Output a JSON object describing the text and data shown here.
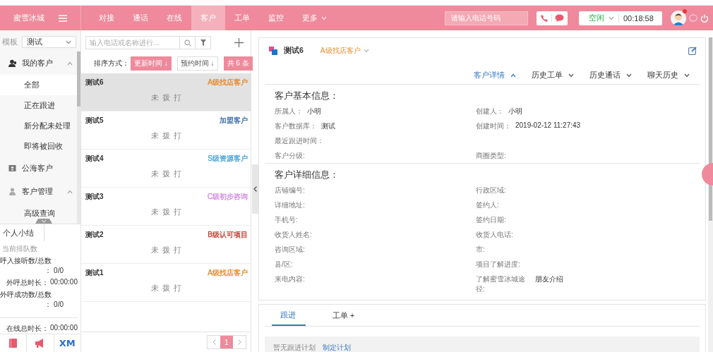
{
  "header": {
    "brand": "蜜雪冰城",
    "tabs": [
      {
        "label": "对接",
        "selected": false,
        "dropdown": false
      },
      {
        "label": "通话",
        "selected": false,
        "dropdown": false
      },
      {
        "label": "在线",
        "selected": false,
        "dropdown": false
      },
      {
        "label": "客户",
        "selected": true,
        "dropdown": false
      },
      {
        "label": "工单",
        "selected": false,
        "dropdown": false
      },
      {
        "label": "监控",
        "selected": false,
        "dropdown": false
      },
      {
        "label": "更多",
        "selected": false,
        "dropdown": true
      }
    ],
    "phone_input": {
      "placeholder": "请输入电话号码"
    },
    "agent_status": {
      "value": "空闲",
      "timer": "00:18:58"
    },
    "avatar": {
      "unread": true
    }
  },
  "sidebar": {
    "template_label": "模板",
    "template_value": "测试",
    "menu": [
      {
        "kind": "group",
        "label": "我的客户",
        "expanded": true,
        "children": [
          {
            "label": "全部",
            "selected": true
          },
          {
            "label": "正在跟进",
            "selected": false
          },
          {
            "label": "新分配未处理",
            "selected": false
          },
          {
            "label": "即将被回收",
            "selected": false
          }
        ]
      },
      {
        "kind": "link",
        "label": "公海客户"
      },
      {
        "kind": "group",
        "label": "客户管理",
        "expanded": true,
        "children": [
          {
            "label": "高级查询",
            "selected": false
          }
        ]
      }
    ],
    "summary": {
      "tab": "个人小结",
      "rows": [
        {
          "kind": "caption",
          "label": "当前排队数"
        },
        {
          "kind": "stacked",
          "label": "呼入接听数/总数",
          "value": "： 0/0"
        },
        {
          "kind": "inline",
          "label": "外呼总时长：",
          "value": "00:00:00"
        },
        {
          "kind": "stacked",
          "label": "外呼成功数/总数",
          "value": "： 0/0"
        },
        {
          "kind": "inline",
          "label": "在线总时长：",
          "value": "00:00:00"
        }
      ]
    },
    "footer": {
      "logo_text": "XM"
    }
  },
  "list": {
    "search": {
      "placeholder": "输入电话或名称进行..."
    },
    "sort_label": "排序方式：",
    "sort_options": [
      {
        "label": "更新时间 ↓",
        "selected": true
      },
      {
        "label": "预约时间 ↓",
        "selected": false
      }
    ],
    "total": "共 6 条",
    "customers": [
      {
        "name": "测试6",
        "tag": "A级找店客户",
        "color": "#e8892b",
        "status": "未 拨 打",
        "selected": true
      },
      {
        "name": "测试5",
        "tag": "加盟客户",
        "color": "#3f6fa8",
        "status": "未 拨 打",
        "selected": false
      },
      {
        "name": "测试4",
        "tag": "S级资源客户",
        "color": "#4aa3d8",
        "status": "未 拨 打",
        "selected": false
      },
      {
        "name": "测试3",
        "tag": "C级初步咨询",
        "color": "#d48be0",
        "status": "未 拨 打",
        "selected": false
      },
      {
        "name": "测试2",
        "tag": "B级认可项目",
        "color": "#c0392b",
        "status": "未 拨 打",
        "selected": false
      },
      {
        "name": "测试1",
        "tag": "A级找店客户",
        "color": "#e8892b",
        "status": "未 拨 打",
        "selected": false
      }
    ],
    "pagination": [
      {
        "label": "1",
        "selected": true
      }
    ]
  },
  "detail": {
    "name": "测试6",
    "level": "A级找店客户",
    "tabs": [
      {
        "label": "客户详情",
        "selected": true
      },
      {
        "label": "历史工单",
        "selected": false
      },
      {
        "label": "历史通话",
        "selected": false
      },
      {
        "label": "聊天历史",
        "selected": false
      }
    ],
    "sections": [
      {
        "title": "客户基本信息：",
        "rows": [
          {
            "left": {
              "label": "所属人：",
              "value": "小明"
            },
            "right": {
              "label": "创建人：",
              "value": "小明"
            }
          },
          {
            "left": {
              "label": "客户数据库：",
              "value": "测试"
            },
            "right": {
              "label": "创建时间：",
              "value": "2019-02-12 11:27:43"
            }
          },
          {
            "left": {
              "label": "最近跟进时间："
            }
          },
          {
            "left": {
              "label": "客户分级:"
            },
            "right": {
              "label": "商圈类型:"
            }
          }
        ]
      },
      {
        "title": "客户详细信息：",
        "rows": [
          {
            "left": {
              "label": "店铺编号:"
            },
            "right": {
              "label": "行政区域:"
            }
          },
          {
            "left": {
              "label": "详细地址:"
            },
            "right": {
              "label": "签约人:"
            }
          },
          {
            "left": {
              "label": "手机号:"
            },
            "right": {
              "label": "签约日期:"
            }
          },
          {
            "left": {
              "label": "收货人姓名:"
            },
            "right": {
              "label": "收货人电话:"
            }
          },
          {
            "left": {
              "label": "咨询区域:"
            },
            "right": {
              "label": "市:"
            }
          },
          {
            "left": {
              "label": "县/区:"
            },
            "right": {
              "label": "项目了解进度:"
            }
          },
          {
            "left": {
              "label": "来电内容:"
            },
            "right": {
              "label": "了解蜜雪冰城途径:",
              "value": "朋友介绍"
            }
          }
        ]
      }
    ],
    "bottom_tabs": [
      {
        "label": "跟进",
        "selected": true
      },
      {
        "label": "工单 +",
        "selected": false
      }
    ],
    "empty_text": "暂无跟进计划",
    "action_link": "制定计划"
  }
}
